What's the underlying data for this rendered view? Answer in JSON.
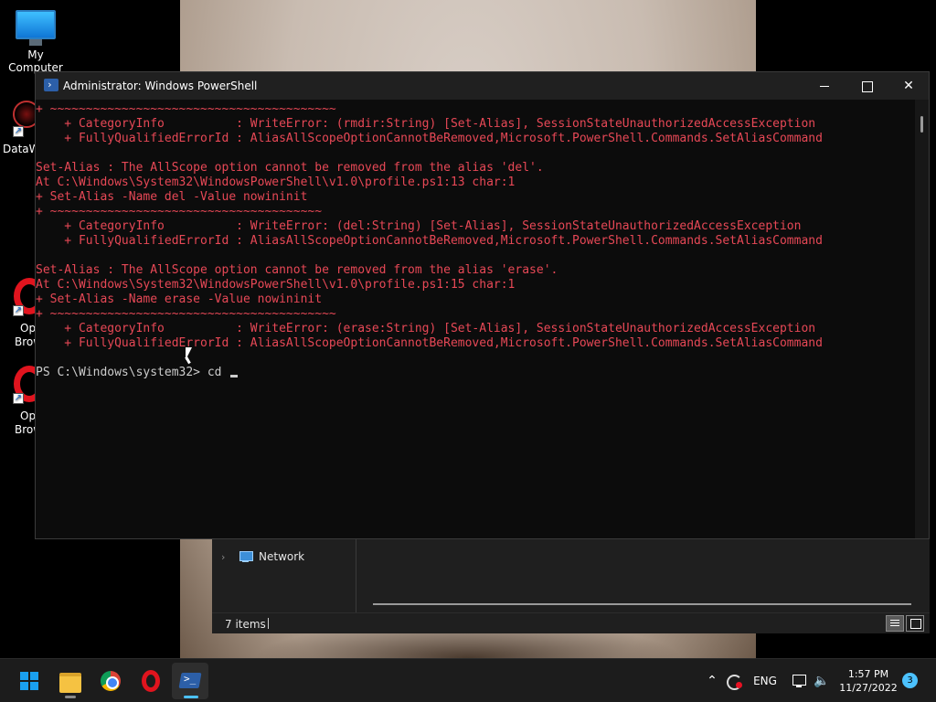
{
  "desktop": {
    "icons": [
      {
        "label": "My Computer"
      },
      {
        "label": "DataW"
      },
      {
        "label_line1": "Op",
        "label_line2": "Brow"
      },
      {
        "label_line1": "Op",
        "label_line2": "Brow"
      }
    ]
  },
  "explorer": {
    "nav_item": "Network",
    "status_items": "7 items"
  },
  "powershell": {
    "title": "Administrator: Windows PowerShell",
    "lines": [
      "+ ~~~~~~~~~~~~~~~~~~~~~~~~~~~~~~~~~~~~~~~~",
      "    + CategoryInfo          : WriteError: (rmdir:String) [Set-Alias], SessionStateUnauthorizedAccessException",
      "    + FullyQualifiedErrorId : AliasAllScopeOptionCannotBeRemoved,Microsoft.PowerShell.Commands.SetAliasCommand",
      "",
      "Set-Alias : The AllScope option cannot be removed from the alias 'del'.",
      "At C:\\Windows\\System32\\WindowsPowerShell\\v1.0\\profile.ps1:13 char:1",
      "+ Set-Alias -Name del -Value nowininit",
      "+ ~~~~~~~~~~~~~~~~~~~~~~~~~~~~~~~~~~~~~~",
      "    + CategoryInfo          : WriteError: (del:String) [Set-Alias], SessionStateUnauthorizedAccessException",
      "    + FullyQualifiedErrorId : AliasAllScopeOptionCannotBeRemoved,Microsoft.PowerShell.Commands.SetAliasCommand",
      "",
      "Set-Alias : The AllScope option cannot be removed from the alias 'erase'.",
      "At C:\\Windows\\System32\\WindowsPowerShell\\v1.0\\profile.ps1:15 char:1",
      "+ Set-Alias -Name erase -Value nowininit",
      "+ ~~~~~~~~~~~~~~~~~~~~~~~~~~~~~~~~~~~~~~~~",
      "    + CategoryInfo          : WriteError: (erase:String) [Set-Alias], SessionStateUnauthorizedAccessException",
      "    + FullyQualifiedErrorId : AliasAllScopeOptionCannotBeRemoved,Microsoft.PowerShell.Commands.SetAliasCommand",
      ""
    ],
    "prompt": "PS C:\\Windows\\system32> ",
    "input": "cd "
  },
  "taskbar": {
    "apps": [
      {
        "name": "start",
        "active": false
      },
      {
        "name": "file-explorer",
        "active": false
      },
      {
        "name": "chrome",
        "active": false
      },
      {
        "name": "opera",
        "active": false
      },
      {
        "name": "powershell",
        "active": true
      }
    ],
    "language": "ENG",
    "time": "1:57 PM",
    "date": "11/27/2022",
    "notification_count": "3"
  },
  "colors": {
    "error_text": "#e74856",
    "console_text": "#cccccc",
    "console_bg": "#0c0c0c",
    "accent": "#4cc2ff"
  }
}
